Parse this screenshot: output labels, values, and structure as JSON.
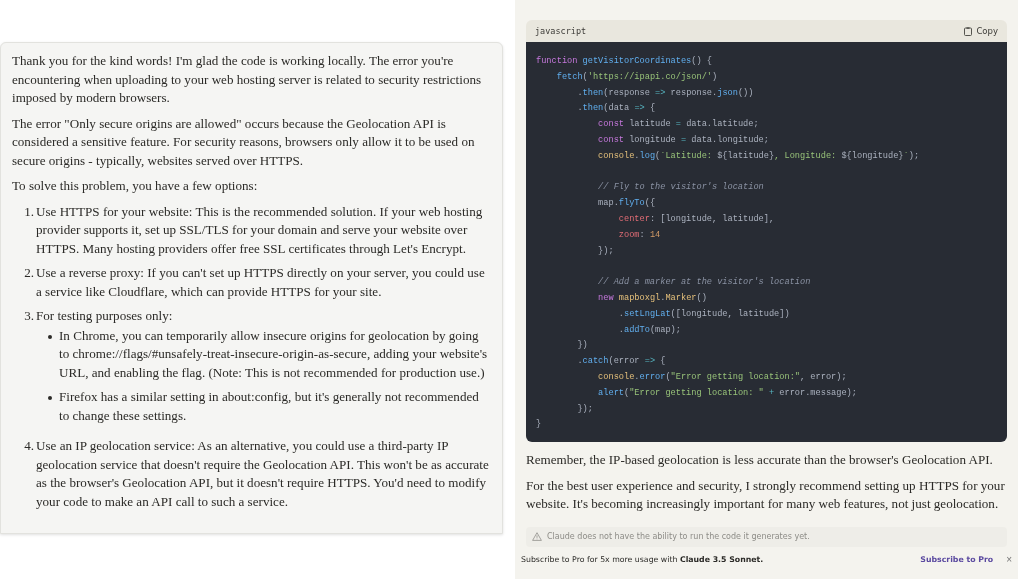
{
  "response": {
    "paragraphs": [
      "Thank you for the kind words! I'm glad the code is working locally. The error you're encountering when uploading to your web hosting server is related to security restrictions imposed by modern browsers.",
      "The error \"Only secure origins are allowed\" occurs because the Geolocation API is considered a sensitive feature. For security reasons, browsers only allow it to be used on secure origins - typically, websites served over HTTPS.",
      "To solve this problem, you have a few options:"
    ],
    "options": [
      {
        "number": "1.",
        "text": "Use HTTPS for your website: This is the recommended solution. If your web hosting provider supports it, set up SSL/TLS for your domain and serve your website over HTTPS. Many hosting providers offer free SSL certificates through Let's Encrypt."
      },
      {
        "number": "2.",
        "text": "Use a reverse proxy: If you can't set up HTTPS directly on your server, you could use a service like Cloudflare, which can provide HTTPS for your site."
      },
      {
        "number": "3.",
        "text": "For testing purposes only:",
        "bullets": [
          "In Chrome, you can temporarily allow insecure origins for geolocation by going to chrome://flags/#unsafely-treat-insecure-origin-as-secure, adding your website's URL, and enabling the flag. (Note: This is not recommended for production use.)",
          "Firefox has a similar setting in about:config, but it's generally not recommended to change these settings."
        ]
      },
      {
        "number": "4.",
        "text": "Use an IP geolocation service: As an alternative, you could use a third-party IP geolocation service that doesn't require the Geolocation API. This won't be as accurate as the browser's Geolocation API, but it doesn't require HTTPS. You'd need to modify your code to make an API call to such a service."
      }
    ]
  },
  "code_block": {
    "language": "javascript",
    "copy_label": "Copy",
    "lines": [
      {
        "kind": "code",
        "tokens": [
          {
            "kind": "keyword",
            "t": "function "
          },
          {
            "kind": "function",
            "t": "getVisitorCoordinates"
          },
          {
            "kind": "plain",
            "t": "() {"
          }
        ]
      },
      {
        "kind": "code",
        "tokens": [
          {
            "kind": "function",
            "t": "    fetch"
          },
          {
            "kind": "plain",
            "t": "("
          },
          {
            "kind": "string",
            "t": "'https://ipapi.co/json/'"
          },
          {
            "kind": "plain",
            "t": ")"
          }
        ]
      },
      {
        "kind": "code",
        "tokens": [
          {
            "kind": "plain",
            "t": "        ."
          },
          {
            "kind": "function",
            "t": "then"
          },
          {
            "kind": "plain",
            "t": "(response "
          },
          {
            "kind": "operator",
            "t": "=>"
          },
          {
            "kind": "plain",
            "t": " response."
          },
          {
            "kind": "function",
            "t": "json"
          },
          {
            "kind": "plain",
            "t": "())"
          }
        ]
      },
      {
        "kind": "code",
        "tokens": [
          {
            "kind": "plain",
            "t": "        ."
          },
          {
            "kind": "function",
            "t": "then"
          },
          {
            "kind": "plain",
            "t": "(data "
          },
          {
            "kind": "operator",
            "t": "=>"
          },
          {
            "kind": "plain",
            "t": " {"
          }
        ]
      },
      {
        "kind": "code",
        "tokens": [
          {
            "kind": "keyword",
            "t": "            const"
          },
          {
            "kind": "plain",
            "t": " latitude "
          },
          {
            "kind": "operator",
            "t": "="
          },
          {
            "kind": "plain",
            "t": " data.latitude;"
          }
        ]
      },
      {
        "kind": "code",
        "tokens": [
          {
            "kind": "keyword",
            "t": "            const"
          },
          {
            "kind": "plain",
            "t": " longitude "
          },
          {
            "kind": "operator",
            "t": "="
          },
          {
            "kind": "plain",
            "t": " data.longitude;"
          }
        ]
      },
      {
        "kind": "code",
        "tokens": [
          {
            "kind": "object",
            "t": "            console"
          },
          {
            "kind": "plain",
            "t": "."
          },
          {
            "kind": "function",
            "t": "log"
          },
          {
            "kind": "plain",
            "t": "("
          },
          {
            "kind": "string",
            "t": "`Latitude: "
          },
          {
            "kind": "plain",
            "t": "${latitude}"
          },
          {
            "kind": "string",
            "t": ", Longitude: "
          },
          {
            "kind": "plain",
            "t": "${longitude}"
          },
          {
            "kind": "string",
            "t": "`"
          },
          {
            "kind": "plain",
            "t": ");"
          }
        ]
      },
      {
        "kind": "blank"
      },
      {
        "kind": "code",
        "tokens": [
          {
            "kind": "comment",
            "t": "            // Fly to the visitor's location"
          }
        ]
      },
      {
        "kind": "code",
        "tokens": [
          {
            "kind": "plain",
            "t": "            map."
          },
          {
            "kind": "function",
            "t": "flyTo"
          },
          {
            "kind": "plain",
            "t": "({"
          }
        ]
      },
      {
        "kind": "code",
        "tokens": [
          {
            "kind": "property",
            "t": "                center"
          },
          {
            "kind": "plain",
            "t": ": [longitude, latitude],"
          }
        ]
      },
      {
        "kind": "code",
        "tokens": [
          {
            "kind": "property",
            "t": "                zoom"
          },
          {
            "kind": "plain",
            "t": ": "
          },
          {
            "kind": "number",
            "t": "14"
          }
        ]
      },
      {
        "kind": "code",
        "tokens": [
          {
            "kind": "plain",
            "t": "            });"
          }
        ]
      },
      {
        "kind": "blank"
      },
      {
        "kind": "code",
        "tokens": [
          {
            "kind": "comment",
            "t": "            // Add a marker at the visitor's location"
          }
        ]
      },
      {
        "kind": "code",
        "tokens": [
          {
            "kind": "keyword",
            "t": "            new "
          },
          {
            "kind": "object",
            "t": "mapboxgl"
          },
          {
            "kind": "plain",
            "t": "."
          },
          {
            "kind": "object",
            "t": "Marker"
          },
          {
            "kind": "plain",
            "t": "()"
          }
        ]
      },
      {
        "kind": "code",
        "tokens": [
          {
            "kind": "plain",
            "t": "                ."
          },
          {
            "kind": "function",
            "t": "setLngLat"
          },
          {
            "kind": "plain",
            "t": "([longitude, latitude])"
          }
        ]
      },
      {
        "kind": "code",
        "tokens": [
          {
            "kind": "plain",
            "t": "                ."
          },
          {
            "kind": "function",
            "t": "addTo"
          },
          {
            "kind": "plain",
            "t": "(map);"
          }
        ]
      },
      {
        "kind": "code",
        "tokens": [
          {
            "kind": "plain",
            "t": "        })"
          }
        ]
      },
      {
        "kind": "code",
        "tokens": [
          {
            "kind": "plain",
            "t": "        ."
          },
          {
            "kind": "function",
            "t": "catch"
          },
          {
            "kind": "plain",
            "t": "(error "
          },
          {
            "kind": "operator",
            "t": "=>"
          },
          {
            "kind": "plain",
            "t": " {"
          }
        ]
      },
      {
        "kind": "code",
        "tokens": [
          {
            "kind": "object",
            "t": "            console"
          },
          {
            "kind": "plain",
            "t": "."
          },
          {
            "kind": "function",
            "t": "error"
          },
          {
            "kind": "plain",
            "t": "("
          },
          {
            "kind": "string",
            "t": "\"Error getting location:\""
          },
          {
            "kind": "plain",
            "t": ", error);"
          }
        ]
      },
      {
        "kind": "code",
        "tokens": [
          {
            "kind": "function",
            "t": "            alert"
          },
          {
            "kind": "plain",
            "t": "("
          },
          {
            "kind": "string",
            "t": "\"Error getting location: \""
          },
          {
            "kind": "operator",
            "t": " + "
          },
          {
            "kind": "plain",
            "t": "error.message);"
          }
        ]
      },
      {
        "kind": "code",
        "tokens": [
          {
            "kind": "plain",
            "t": "        });"
          }
        ]
      },
      {
        "kind": "code",
        "tokens": [
          {
            "kind": "plain",
            "t": "}"
          }
        ]
      }
    ]
  },
  "closing_paragraphs": [
    "Remember, the IP-based geolocation is less accurate than the browser's Geolocation API.",
    "For the best user experience and security, I strongly recommend setting up HTTPS for your website. It's becoming increasingly important for many web features, not just geolocation."
  ],
  "notice": "Claude does not have the ability to run the code it generates yet.",
  "banner": {
    "text": "Subscribe to Pro for 5x more usage with **Claude 3.5 Sonnet.**",
    "link": "Subscribe to Pro",
    "close": "×"
  }
}
